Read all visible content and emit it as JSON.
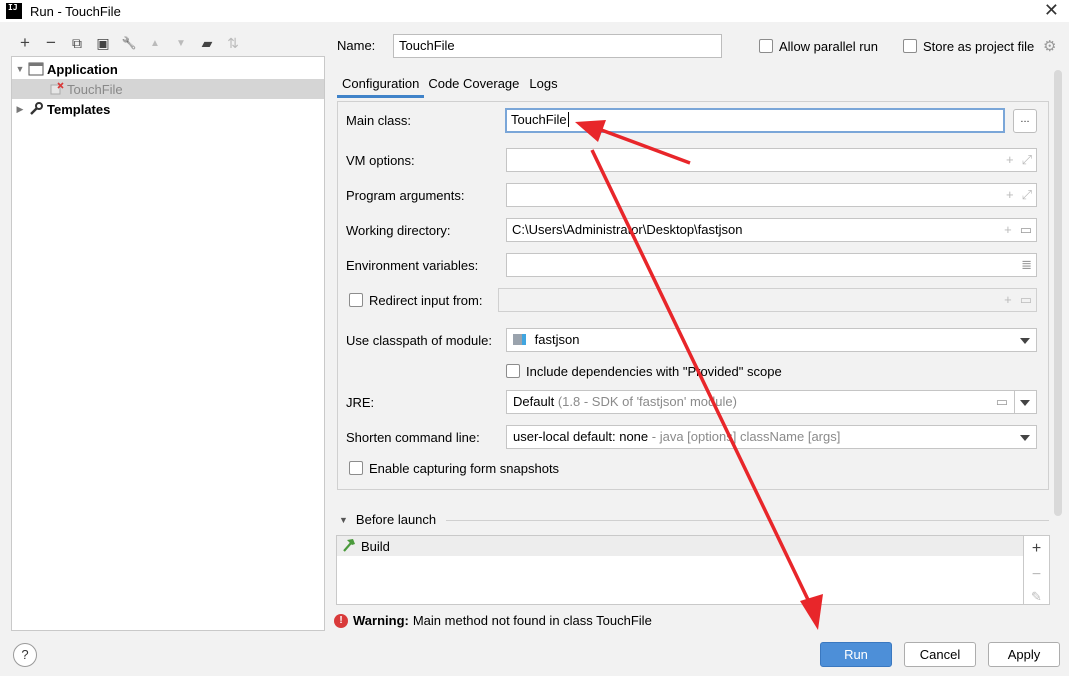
{
  "window": {
    "app_icon_text": "IJ",
    "title": "Run - TouchFile",
    "close_glyph": "✕"
  },
  "toolbar": {
    "add_glyph": "+",
    "remove_glyph": "−",
    "copy_glyph": "⧉",
    "save_glyph": "▣",
    "edit_glyph": "🔧",
    "up_glyph": "▲",
    "down_glyph": "▼",
    "folder_glyph": "▰",
    "sort_glyph": "⇅"
  },
  "tree": {
    "application_label": "Application",
    "touchfile_label": "TouchFile",
    "templates_label": "Templates"
  },
  "header": {
    "name_label": "Name:",
    "name_value": "TouchFile",
    "allow_parallel_label": "Allow parallel run",
    "store_project_label": "Store as project file"
  },
  "tabs": [
    {
      "label": "Configuration"
    },
    {
      "label": "Code Coverage"
    },
    {
      "label": "Logs"
    }
  ],
  "config": {
    "main_class_label": "Main class:",
    "main_class_value": "TouchFile",
    "browse_label": "...",
    "vm_options_label": "VM options:",
    "program_args_label": "Program arguments:",
    "working_dir_label": "Working directory:",
    "working_dir_value": "C:\\Users\\Administrator\\Desktop\\fastjson",
    "env_vars_label": "Environment variables:",
    "redirect_input_label": "Redirect input from:",
    "classpath_label": "Use classpath of module:",
    "classpath_value": "fastjson",
    "include_deps_label": "Include dependencies with \"Provided\" scope",
    "jre_label": "JRE:",
    "jre_value": "Default",
    "jre_hint": "(1.8 - SDK of 'fastjson' module)",
    "shorten_label": "Shorten command line:",
    "shorten_value": "user-local default: none",
    "shorten_hint": "- java [options] className [args]",
    "snapshots_label": "Enable capturing form snapshots"
  },
  "before_launch": {
    "title": "Before launch",
    "items": [
      {
        "label": "Build"
      }
    ],
    "add_glyph": "+",
    "remove_glyph": "−",
    "edit_glyph": "✎"
  },
  "warning": {
    "title": "Warning:",
    "message": "Main method not found in class TouchFile"
  },
  "footer": {
    "help_label": "?",
    "run_label": "Run",
    "cancel_label": "Cancel",
    "apply_label": "Apply"
  },
  "colors": {
    "accent": "#4d8fd8",
    "annotation_arrow": "#e8262a",
    "warning": "#d93a3a"
  }
}
